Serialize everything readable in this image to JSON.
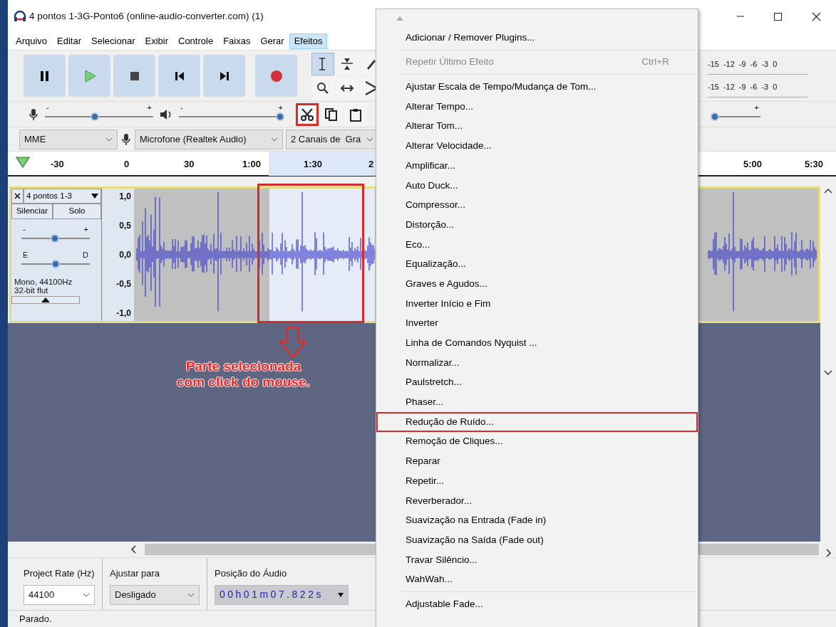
{
  "window": {
    "title": "4 pontos 1-3G-Ponto6 (online-audio-converter.com) (1)"
  },
  "menu_bar": [
    {
      "label": "Arquivo",
      "selected": false
    },
    {
      "label": "Editar",
      "selected": false
    },
    {
      "label": "Selecionar",
      "selected": false
    },
    {
      "label": "Exibir",
      "selected": false
    },
    {
      "label": "Controle",
      "selected": false
    },
    {
      "label": "Faixas",
      "selected": false
    },
    {
      "label": "Gerar",
      "selected": false
    },
    {
      "label": "Efeitos",
      "selected": true
    }
  ],
  "transport": [
    {
      "kind": "pause"
    },
    {
      "kind": "play"
    },
    {
      "kind": "stop"
    },
    {
      "kind": "skip-start"
    },
    {
      "kind": "skip-end"
    },
    {
      "kind": "record"
    }
  ],
  "tools": [
    {
      "kind": "select",
      "selected": true
    },
    {
      "kind": "envelope",
      "selected": false
    },
    {
      "kind": "draw",
      "selected": false
    },
    {
      "kind": "zoom",
      "selected": false
    },
    {
      "kind": "timeshift",
      "selected": false
    },
    {
      "kind": "multi",
      "selected": false
    }
  ],
  "edit_tools": [
    {
      "kind": "cut",
      "annotated": true
    },
    {
      "kind": "copy",
      "annotated": false
    },
    {
      "kind": "paste",
      "annotated": false
    }
  ],
  "meters": [
    {
      "ticks": [
        "-15",
        "-12",
        "-9",
        "-6",
        "-3",
        "0"
      ]
    },
    {
      "ticks": [
        "-15",
        "-12",
        "-9",
        "-6",
        "-3",
        "0"
      ]
    }
  ],
  "mixer": {
    "recording": {
      "min_label": "-",
      "max_label": "+",
      "level": 0.46
    },
    "playback": {
      "min_label": "-",
      "max_label": "+",
      "level": 1.0
    },
    "speed": {
      "max_label": "+",
      "level": 0.0
    }
  },
  "devices": {
    "host": "MME",
    "input": "Microfone (Realtek Audio)",
    "channels": "2 Canais de  Gra"
  },
  "ruler": {
    "labels": [
      "-30",
      "0",
      "30",
      "1:00",
      "1:30",
      "2"
    ],
    "right_labels": [
      "5:00",
      "5:30"
    ]
  },
  "track": {
    "name": "4 pontos 1-3",
    "mute_label": "Silenciar",
    "solo_label": "Solo",
    "gain": {
      "min_label": "-",
      "max_label": "+",
      "level": 0.49
    },
    "pan": {
      "min_label": "E",
      "max_label": "D",
      "level": 0.5
    },
    "info": [
      "Mono, 44100Hz",
      "32-bit flut"
    ],
    "scale": [
      "1,0",
      "0,5",
      "0,0",
      "-0,5",
      "-1,0"
    ],
    "selection_annotated": true
  },
  "annotation": {
    "lines": [
      "Parte selecionada",
      "com click do mouse."
    ]
  },
  "selection_toolbar": {
    "project_rate": {
      "label": "Project Rate (Hz)",
      "value": "44100"
    },
    "snap": {
      "label": "Ajustar para",
      "value": "Desligado"
    },
    "position": {
      "label": "Posição do Áudio",
      "value": "00h01m07.822s"
    }
  },
  "status_bar": {
    "text": "Parado."
  },
  "effects_menu": [
    {
      "kind": "item",
      "label": "Adicionar / Remover Plugins...",
      "disabled": false,
      "annotated": false
    },
    {
      "kind": "separator"
    },
    {
      "kind": "item",
      "label": "Repetir Último Efeito",
      "shortcut": "Ctrl+R",
      "disabled": true,
      "annotated": false
    },
    {
      "kind": "separator"
    },
    {
      "kind": "item",
      "label": "Ajustar Escala de Tempo/Mudança de Tom...",
      "disabled": false,
      "annotated": false
    },
    {
      "kind": "item",
      "label": "Alterar Tempo...",
      "disabled": false,
      "annotated": false
    },
    {
      "kind": "item",
      "label": "Alterar Tom...",
      "disabled": false,
      "annotated": false
    },
    {
      "kind": "item",
      "label": "Alterar Velocidade...",
      "disabled": false,
      "annotated": false
    },
    {
      "kind": "item",
      "label": "Amplificar...",
      "disabled": false,
      "annotated": false
    },
    {
      "kind": "item",
      "label": "Auto Duck...",
      "disabled": false,
      "annotated": false
    },
    {
      "kind": "item",
      "label": "Compressor...",
      "disabled": false,
      "annotated": false
    },
    {
      "kind": "item",
      "label": "Distorção...",
      "disabled": false,
      "annotated": false
    },
    {
      "kind": "item",
      "label": "Eco...",
      "disabled": false,
      "annotated": false
    },
    {
      "kind": "item",
      "label": "Equalização...",
      "disabled": false,
      "annotated": false
    },
    {
      "kind": "item",
      "label": "Graves e Agudos...",
      "disabled": false,
      "annotated": false
    },
    {
      "kind": "item",
      "label": "Inverter Início e Fim",
      "disabled": false,
      "annotated": false
    },
    {
      "kind": "item",
      "label": "Inverter",
      "disabled": false,
      "annotated": false
    },
    {
      "kind": "item",
      "label": "Linha de Comandos Nyquist ...",
      "disabled": false,
      "annotated": false
    },
    {
      "kind": "item",
      "label": "Normalizar...",
      "disabled": false,
      "annotated": false
    },
    {
      "kind": "item",
      "label": "Paulstretch...",
      "disabled": false,
      "annotated": false
    },
    {
      "kind": "item",
      "label": "Phaser...",
      "disabled": false,
      "annotated": false
    },
    {
      "kind": "item",
      "label": "Redução de Ruído...",
      "disabled": false,
      "annotated": true
    },
    {
      "kind": "item",
      "label": "Remoção de Cliques...",
      "disabled": false,
      "annotated": false
    },
    {
      "kind": "item",
      "label": "Reparar",
      "disabled": false,
      "annotated": false
    },
    {
      "kind": "item",
      "label": "Repetir...",
      "disabled": false,
      "annotated": false
    },
    {
      "kind": "item",
      "label": "Reverberador...",
      "disabled": false,
      "annotated": false
    },
    {
      "kind": "item",
      "label": "Suavização na Entrada (Fade in)",
      "disabled": false,
      "annotated": false
    },
    {
      "kind": "item",
      "label": "Suavização na Saída (Fade out)",
      "disabled": false,
      "annotated": false
    },
    {
      "kind": "item",
      "label": "Travar Silêncio...",
      "disabled": false,
      "annotated": false
    },
    {
      "kind": "item",
      "label": "WahWah...",
      "disabled": false,
      "annotated": false
    },
    {
      "kind": "separator"
    },
    {
      "kind": "item",
      "label": "Adjustable Fade...",
      "disabled": false,
      "annotated": false
    }
  ]
}
